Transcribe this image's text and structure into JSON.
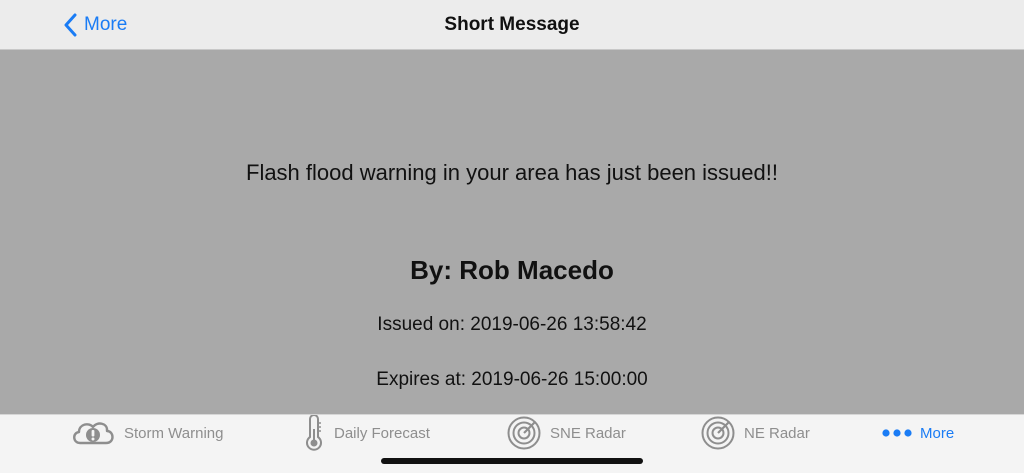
{
  "nav": {
    "back_label": "More",
    "title": "Short Message"
  },
  "message": {
    "text": "Flash flood warning in your area has just been issued!!",
    "author": "By: Rob Macedo",
    "issued": "Issued on: 2019-06-26 13:58:42",
    "expires": "Expires at: 2019-06-26 15:00:00"
  },
  "tabs": [
    {
      "label": "Storm Warning",
      "icon": "storm-warning-icon",
      "active": false
    },
    {
      "label": "Daily Forecast",
      "icon": "thermometer-icon",
      "active": false
    },
    {
      "label": "SNE Radar",
      "icon": "radar-icon",
      "active": false
    },
    {
      "label": "NE Radar",
      "icon": "radar-icon",
      "active": false
    },
    {
      "label": "More",
      "icon": "more-dots-icon",
      "active": true
    }
  ],
  "colors": {
    "accent": "#1a7cf5",
    "content_background": "#a9a9a9",
    "inactive_tab": "#8e8e8e"
  }
}
